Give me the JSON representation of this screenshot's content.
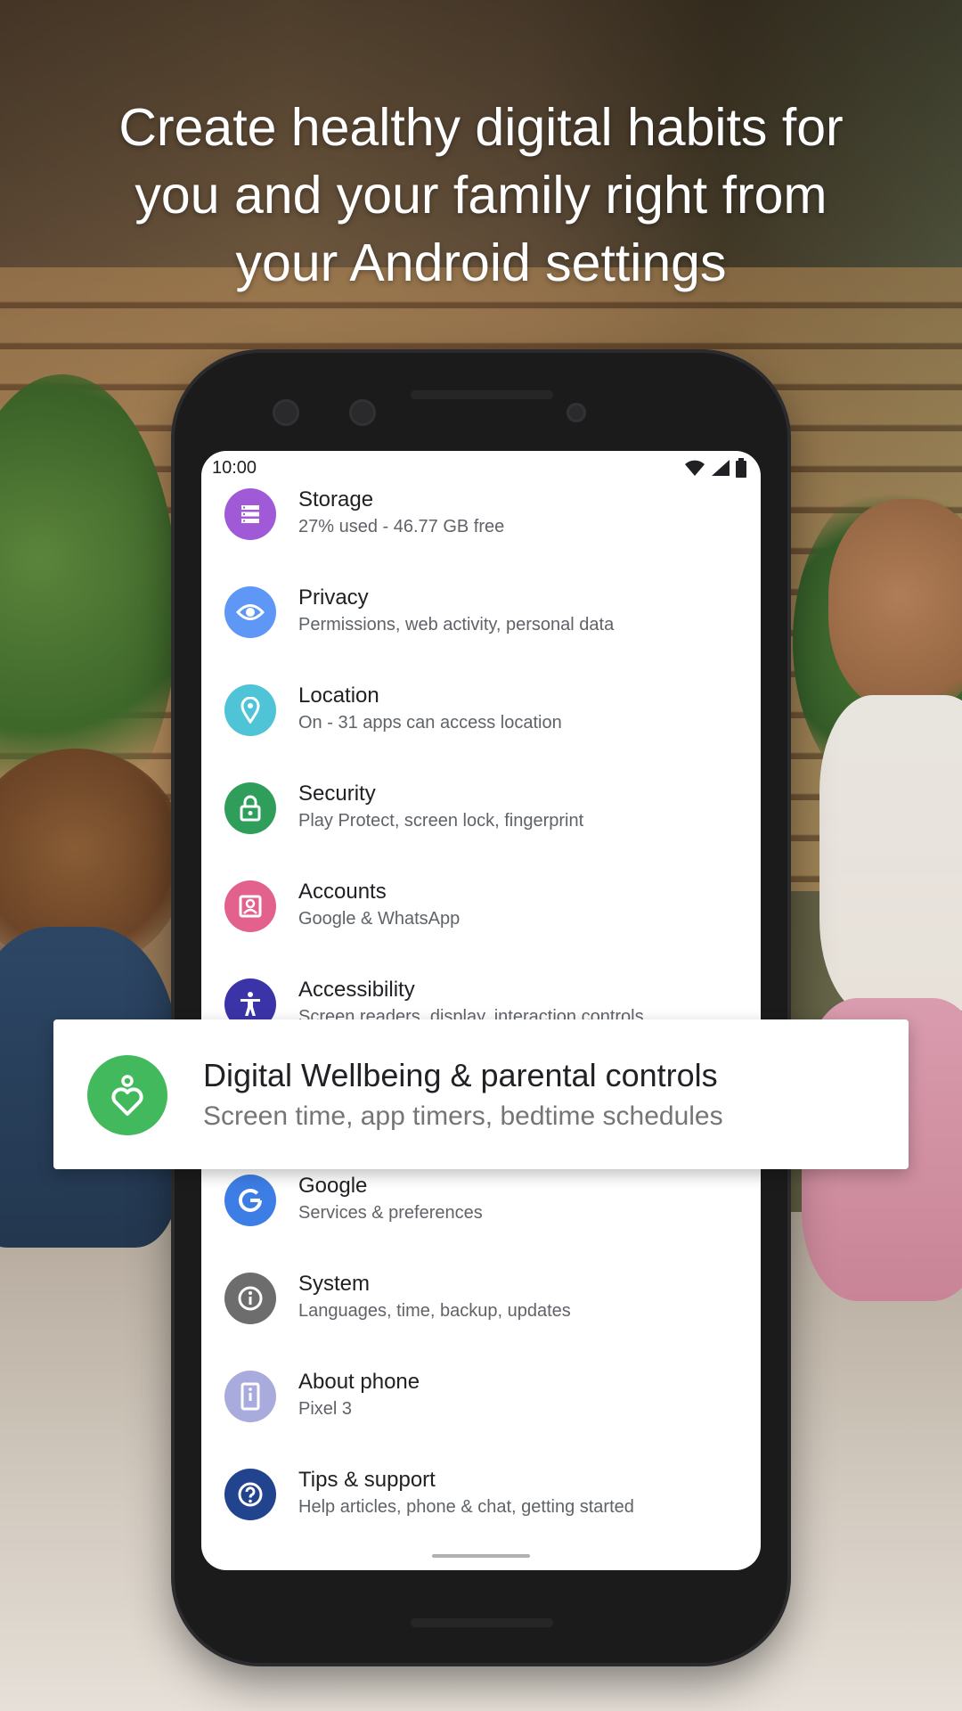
{
  "headline": {
    "line1": "Create healthy digital habits for",
    "line2": "you and your family right from",
    "line3": "your Android settings"
  },
  "status_bar": {
    "time": "10:00"
  },
  "settings": [
    {
      "title": "Storage",
      "subtitle": "27% used - 46.77 GB free",
      "icon": "storage-icon",
      "color": "#a05ad7"
    },
    {
      "title": "Privacy",
      "subtitle": "Permissions, web activity, personal data",
      "icon": "eye-icon",
      "color": "#5e97f6"
    },
    {
      "title": "Location",
      "subtitle": "On - 31 apps can access location",
      "icon": "location-pin-icon",
      "color": "#4fc4d6"
    },
    {
      "title": "Security",
      "subtitle": "Play Protect, screen lock, fingerprint",
      "icon": "lock-icon",
      "color": "#2f9e5b"
    },
    {
      "title": "Accounts",
      "subtitle": "Google & WhatsApp",
      "icon": "account-box-icon",
      "color": "#e2628d"
    },
    {
      "title": "Accessibility",
      "subtitle": "Screen readers, display, interaction controls",
      "icon": "accessibility-icon",
      "color": "#3b34a8"
    },
    {
      "title": "Google",
      "subtitle": "Services & preferences",
      "icon": "google-g-icon",
      "color": "#3d7ee6"
    },
    {
      "title": "System",
      "subtitle": "Languages, time, backup, updates",
      "icon": "info-icon",
      "color": "#6d6d6d"
    },
    {
      "title": "About phone",
      "subtitle": "Pixel 3",
      "icon": "phone-info-icon",
      "color": "#a8abdc"
    },
    {
      "title": "Tips & support",
      "subtitle": "Help articles, phone & chat, getting started",
      "icon": "help-icon",
      "color": "#22438e"
    }
  ],
  "highlight": {
    "title": "Digital Wellbeing & parental controls",
    "subtitle": "Screen time, app timers, bedtime schedules",
    "icon": "digital-wellbeing-icon",
    "color": "#43b95d"
  }
}
